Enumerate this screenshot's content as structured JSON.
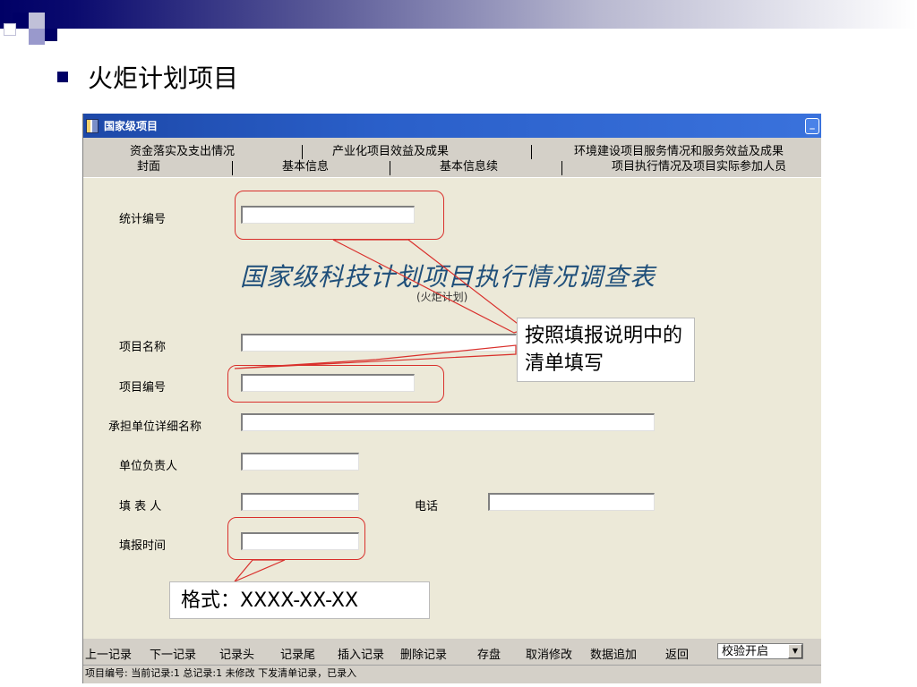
{
  "slide": {
    "title": "火炬计划项目"
  },
  "window": {
    "title": "国家级项目",
    "minimize_label": "_"
  },
  "tabs": {
    "row1": [
      "资金落实及支出情况",
      "产业化项目效益及成果",
      "环境建设项目服务情况和服务效益及成果"
    ],
    "row2": [
      "封面",
      "基本信息",
      "基本信息续",
      "项目执行情况及项目实际参加人员"
    ]
  },
  "form": {
    "title": "国家级科技计划项目执行情况调查表",
    "subtitle": "(火炬计划)",
    "fields": [
      {
        "label": "统计编号",
        "value": ""
      },
      {
        "label": "项目名称",
        "value": ""
      },
      {
        "label": "项目编号",
        "value": ""
      },
      {
        "label": "承担单位详细名称",
        "value": ""
      },
      {
        "label": "单位负责人",
        "value": ""
      },
      {
        "label": "填 表 人",
        "value": ""
      },
      {
        "label": "电话",
        "value": ""
      },
      {
        "label": "填报时间",
        "value": ""
      }
    ]
  },
  "callouts": {
    "fill_note": "按照填报说明中的清单填写",
    "format_note": "格式：XXXX-XX-XX"
  },
  "toolbar": {
    "buttons": [
      "上一记录",
      "下一记录",
      "记录头",
      "记录尾",
      "插入记录",
      "删除记录",
      "存盘",
      "取消修改",
      "数据追加",
      "返回"
    ],
    "combo_value": "校验开启"
  },
  "status": {
    "text": "项目编号:  当前记录:1  总记录:1  未修改  下发清单记录，已录入"
  },
  "colors": {
    "annotation": "#d9302c",
    "form_title": "#1f4f7a",
    "titlebar": "#2a5fc9"
  }
}
